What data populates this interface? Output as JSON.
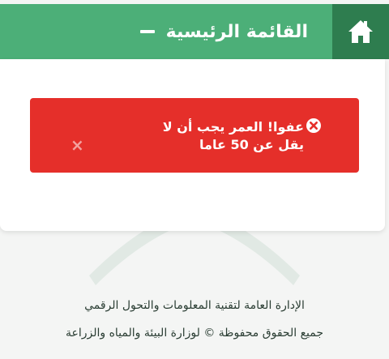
{
  "header": {
    "title": "القائمة الرئيسية",
    "home_icon": "home-icon",
    "collapse_icon": "minus-icon",
    "colors": {
      "bar": "#4caf78",
      "home_box": "#2e7d4f"
    }
  },
  "alert": {
    "message": "عفوا! العمر يجب أن لا يقل عن 50 عاما",
    "error_icon": "close-circle-icon",
    "dismiss_label": "×",
    "color": "#e52f2a"
  },
  "footer": {
    "line1": "الإدارة العامة لتقنية المعلومات والتحول الرقمي",
    "line2": "جميع الحقوق محفوظة © لوزارة البيئة والمياه والزراعة"
  }
}
